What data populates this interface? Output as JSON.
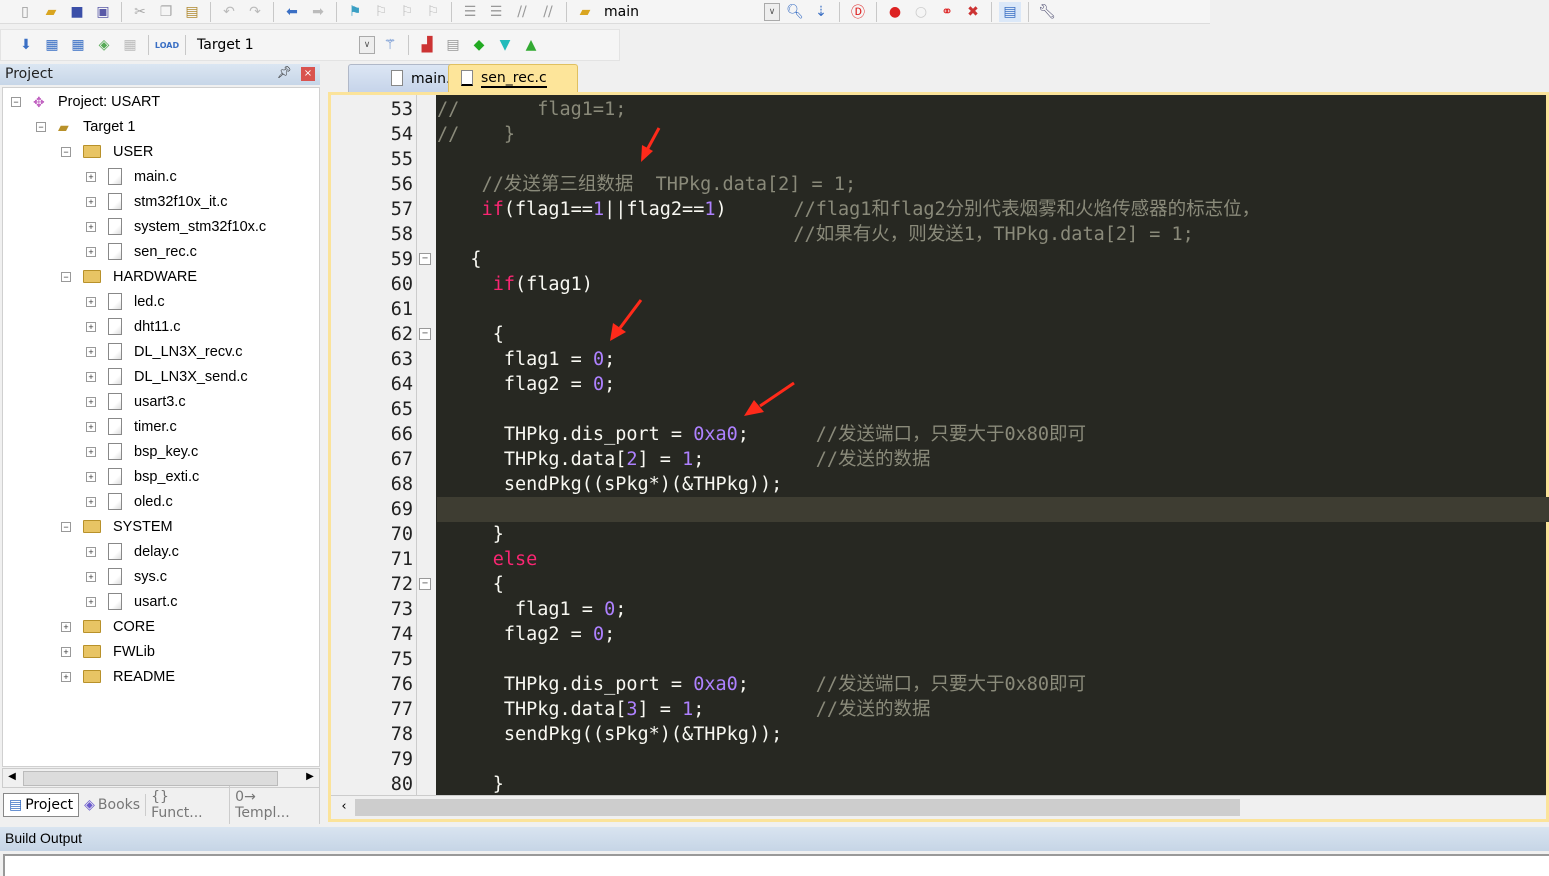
{
  "toolbar1": {
    "target_combo": "main"
  },
  "toolbar2": {
    "target_combo": "Target 1",
    "load_label": "LOAD"
  },
  "project_panel": {
    "title": "Project",
    "tree": [
      {
        "label": "Project: USART",
        "depth": 0,
        "kind": "project",
        "expanded": true
      },
      {
        "label": "Target 1",
        "depth": 1,
        "kind": "target",
        "expanded": true
      },
      {
        "label": "USER",
        "depth": 2,
        "kind": "folder",
        "expanded": true
      },
      {
        "label": "main.c",
        "depth": 3,
        "kind": "file"
      },
      {
        "label": "stm32f10x_it.c",
        "depth": 3,
        "kind": "file"
      },
      {
        "label": "system_stm32f10x.c",
        "depth": 3,
        "kind": "file"
      },
      {
        "label": "sen_rec.c",
        "depth": 3,
        "kind": "file"
      },
      {
        "label": "HARDWARE",
        "depth": 2,
        "kind": "folder",
        "expanded": true
      },
      {
        "label": "led.c",
        "depth": 3,
        "kind": "file"
      },
      {
        "label": "dht11.c",
        "depth": 3,
        "kind": "file"
      },
      {
        "label": "DL_LN3X_recv.c",
        "depth": 3,
        "kind": "file"
      },
      {
        "label": "DL_LN3X_send.c",
        "depth": 3,
        "kind": "file"
      },
      {
        "label": "usart3.c",
        "depth": 3,
        "kind": "file"
      },
      {
        "label": "timer.c",
        "depth": 3,
        "kind": "file"
      },
      {
        "label": "bsp_key.c",
        "depth": 3,
        "kind": "file"
      },
      {
        "label": "bsp_exti.c",
        "depth": 3,
        "kind": "file"
      },
      {
        "label": "oled.c",
        "depth": 3,
        "kind": "file"
      },
      {
        "label": "SYSTEM",
        "depth": 2,
        "kind": "folder",
        "expanded": true
      },
      {
        "label": "delay.c",
        "depth": 3,
        "kind": "file"
      },
      {
        "label": "sys.c",
        "depth": 3,
        "kind": "file"
      },
      {
        "label": "usart.c",
        "depth": 3,
        "kind": "file"
      },
      {
        "label": "CORE",
        "depth": 2,
        "kind": "folder",
        "expanded": false
      },
      {
        "label": "FWLib",
        "depth": 2,
        "kind": "folder",
        "expanded": false
      },
      {
        "label": "README",
        "depth": 2,
        "kind": "folder",
        "expanded": false
      }
    ],
    "bottom_tabs": [
      "Project",
      "Books",
      "{} Funct...",
      "0→ Templ..."
    ]
  },
  "editor": {
    "tabs": [
      {
        "label": "main.c",
        "active": false
      },
      {
        "label": "sen_rec.c",
        "active": true
      }
    ],
    "colors": {
      "background": "#272822",
      "keyword": "#f92672",
      "number": "#ae81ff",
      "comment": "#8a8a7a",
      "text": "#f8f8f2",
      "current_line": "#3e3d32"
    },
    "highlighted_line": 69,
    "lines": [
      {
        "n": 53,
        "tokens": [
          [
            "c",
            "//       flag1=1;"
          ]
        ]
      },
      {
        "n": 54,
        "tokens": [
          [
            "c",
            "//    }"
          ]
        ]
      },
      {
        "n": 55,
        "tokens": []
      },
      {
        "n": 56,
        "tokens": [
          [
            "t",
            "    "
          ],
          [
            "c",
            "//发送第三组数据  THPkg.data[2] = 1;"
          ]
        ]
      },
      {
        "n": 57,
        "tokens": [
          [
            "t",
            "    "
          ],
          [
            "k",
            "if"
          ],
          [
            "t",
            "(flag1=="
          ],
          [
            "n",
            "1"
          ],
          [
            "t",
            "||flag2=="
          ],
          [
            "n",
            "1"
          ],
          [
            "t",
            ")      "
          ],
          [
            "c",
            "//flag1和flag2分别代表烟雾和火焰传感器的标志位，"
          ]
        ]
      },
      {
        "n": 58,
        "tokens": [
          [
            "t",
            "                                "
          ],
          [
            "c",
            "//如果有火，则发送1，THPkg.data[2] = 1;"
          ]
        ]
      },
      {
        "n": 59,
        "tokens": [
          [
            "t",
            "   {"
          ]
        ],
        "fold": true
      },
      {
        "n": 60,
        "tokens": [
          [
            "t",
            "     "
          ],
          [
            "k",
            "if"
          ],
          [
            "t",
            "(flag1)"
          ]
        ]
      },
      {
        "n": 61,
        "tokens": []
      },
      {
        "n": 62,
        "tokens": [
          [
            "t",
            "     {"
          ]
        ],
        "fold": true
      },
      {
        "n": 63,
        "tokens": [
          [
            "t",
            "      flag1 = "
          ],
          [
            "n",
            "0"
          ],
          [
            "t",
            ";"
          ]
        ]
      },
      {
        "n": 64,
        "tokens": [
          [
            "t",
            "      flag2 = "
          ],
          [
            "n",
            "0"
          ],
          [
            "t",
            ";"
          ]
        ]
      },
      {
        "n": 65,
        "tokens": []
      },
      {
        "n": 66,
        "tokens": [
          [
            "t",
            "      THPkg.dis_port = "
          ],
          [
            "n",
            "0xa0"
          ],
          [
            "t",
            ";      "
          ],
          [
            "c",
            "//发送端口，只要大于0x80即可"
          ]
        ]
      },
      {
        "n": 67,
        "tokens": [
          [
            "t",
            "      THPkg.data["
          ],
          [
            "n",
            "2"
          ],
          [
            "t",
            "] = "
          ],
          [
            "n",
            "1"
          ],
          [
            "t",
            ";          "
          ],
          [
            "c",
            "//发送的数据"
          ]
        ]
      },
      {
        "n": 68,
        "tokens": [
          [
            "t",
            "      sendPkg((sPkg*)(&THPkg));"
          ]
        ]
      },
      {
        "n": 69,
        "tokens": []
      },
      {
        "n": 70,
        "tokens": [
          [
            "t",
            "     }"
          ]
        ]
      },
      {
        "n": 71,
        "tokens": [
          [
            "t",
            "     "
          ],
          [
            "k",
            "else"
          ]
        ]
      },
      {
        "n": 72,
        "tokens": [
          [
            "t",
            "     {"
          ]
        ],
        "fold": true
      },
      {
        "n": 73,
        "tokens": [
          [
            "t",
            "       flag1 = "
          ],
          [
            "n",
            "0"
          ],
          [
            "t",
            ";"
          ]
        ]
      },
      {
        "n": 74,
        "tokens": [
          [
            "t",
            "      flag2 = "
          ],
          [
            "n",
            "0"
          ],
          [
            "t",
            ";"
          ]
        ]
      },
      {
        "n": 75,
        "tokens": []
      },
      {
        "n": 76,
        "tokens": [
          [
            "t",
            "      THPkg.dis_port = "
          ],
          [
            "n",
            "0xa0"
          ],
          [
            "t",
            ";      "
          ],
          [
            "c",
            "//发送端口，只要大于0x80即可"
          ]
        ]
      },
      {
        "n": 77,
        "tokens": [
          [
            "t",
            "      THPkg.data["
          ],
          [
            "n",
            "3"
          ],
          [
            "t",
            "] = "
          ],
          [
            "n",
            "1"
          ],
          [
            "t",
            ";          "
          ],
          [
            "c",
            "//发送的数据"
          ]
        ]
      },
      {
        "n": 78,
        "tokens": [
          [
            "t",
            "      sendPkg((sPkg*)(&THPkg));"
          ]
        ]
      },
      {
        "n": 79,
        "tokens": []
      },
      {
        "n": 80,
        "tokens": [
          [
            "t",
            "     }"
          ]
        ]
      }
    ]
  },
  "build_output": {
    "title": "Build Output"
  },
  "annotation_color": "#ff2a1a"
}
